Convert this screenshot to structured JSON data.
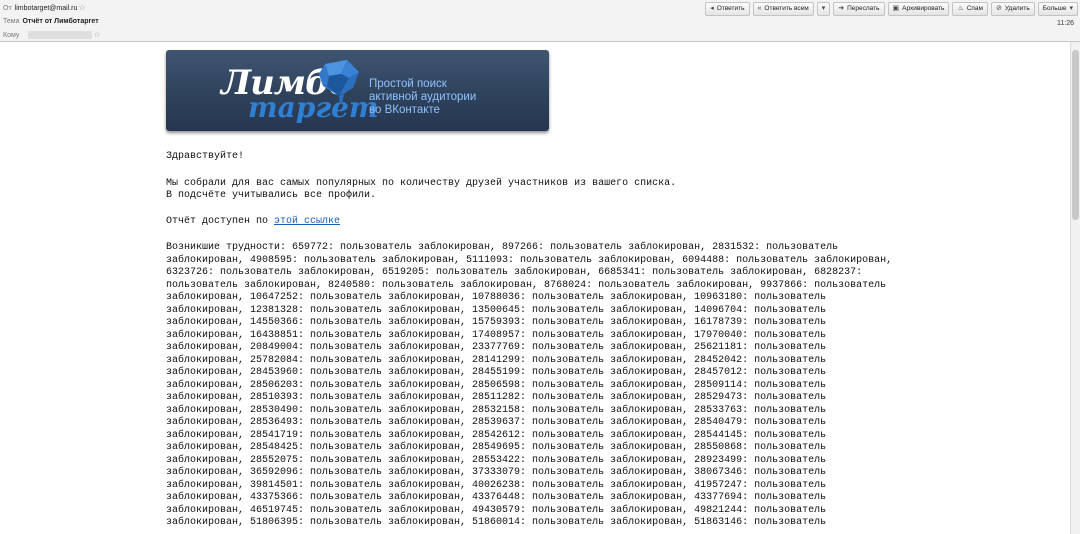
{
  "header": {
    "from_label": "От",
    "from_value": "limbotarget@mail.ru",
    "subject_label": "Тема",
    "subject_value": "Отчёт от Лимботаргет",
    "to_label": "Кому",
    "time": "11:26"
  },
  "toolbar": {
    "reply": "Ответить",
    "reply_all": "Ответить всем",
    "forward": "Переслать",
    "archive": "Архивировать",
    "spam": "Спам",
    "delete": "Удалить",
    "more": "Больше"
  },
  "icons": {
    "reply": "reply-icon",
    "reply_all": "reply-all-icon",
    "dropdown": "chevron-down-icon",
    "forward": "forward-icon",
    "archive": "archive-icon",
    "spam": "spam-icon",
    "delete": "delete-icon"
  },
  "banner": {
    "logo_word1": "Лимбо",
    "logo_word2": "таргет",
    "tagline_1": "Простой поиск",
    "tagline_2": "активной аудитории",
    "tagline_3": "во ВКонтакте"
  },
  "message": {
    "greeting": "Здравствуйте!",
    "intro_1": "Мы собрали для вас самых популярных по количеству друзей участников из вашего списка.",
    "intro_2": "В подсчёте учитывались все профили.",
    "report_prefix": "Отчёт доступен по ",
    "report_link": "этой ссылке",
    "lines": [
      "Возникшие трудности: 659772: пользователь заблокирован, 897266: пользователь заблокирован, 2831532: пользователь",
      "заблокирован, 4908595: пользователь заблокирован, 5111093: пользователь заблокирован, 6094488: пользователь заблокирован,",
      "6323726: пользователь заблокирован, 6519205: пользователь заблокирован, 6685341: пользователь заблокирован, 6828237:",
      "пользователь заблокирован, 8240580: пользователь заблокирован, 8768024: пользователь заблокирован, 9937866: пользователь",
      "заблокирован, 10647252: пользователь заблокирован, 10788036: пользователь заблокирован, 10963180: пользователь",
      "заблокирован, 12381328: пользователь заблокирован, 13500645: пользователь заблокирован, 14096704: пользователь",
      "заблокирован, 14550366: пользователь заблокирован, 15759393: пользователь заблокирован, 16178739: пользователь",
      "заблокирован, 16438851: пользователь заблокирован, 17408957: пользователь заблокирован, 17970040: пользователь",
      "заблокирован, 20849004: пользователь заблокирован, 23377769: пользователь заблокирован, 25621181: пользователь",
      "заблокирован, 25782084: пользователь заблокирован, 28141299: пользователь заблокирован, 28452042: пользователь",
      "заблокирован, 28453960: пользователь заблокирован, 28455199: пользователь заблокирован, 28457012: пользователь",
      "заблокирован, 28506203: пользователь заблокирован, 28506598: пользователь заблокирован, 28509114: пользователь",
      "заблокирован, 28510393: пользователь заблокирован, 28511282: пользователь заблокирован, 28529473: пользователь",
      "заблокирован, 28530490: пользователь заблокирован, 28532158: пользователь заблокирован, 28533763: пользователь",
      "заблокирован, 28536493: пользователь заблокирован, 28539637: пользователь заблокирован, 28540479: пользователь",
      "заблокирован, 28541719: пользователь заблокирован, 28542612: пользователь заблокирован, 28544145: пользователь",
      "заблокирован, 28548425: пользователь заблокирован, 28549695: пользователь заблокирован, 28550868: пользователь",
      "заблокирован, 28552075: пользователь заблокирован, 28553422: пользователь заблокирован, 28923499: пользователь",
      "заблокирован, 36592096: пользователь заблокирован, 37333079: пользователь заблокирован, 38067346: пользователь",
      "заблокирован, 39814501: пользователь заблокирован, 40026238: пользователь заблокирован, 41957247: пользователь",
      "заблокирован, 43375366: пользователь заблокирован, 43376448: пользователь заблокирован, 43377694: пользователь",
      "заблокирован, 46519745: пользователь заблокирован, 49430579: пользователь заблокирован, 49821244: пользователь",
      "заблокирован, 51806395: пользователь заблокирован, 51860014: пользователь заблокирован, 51863146: пользователь"
    ]
  }
}
